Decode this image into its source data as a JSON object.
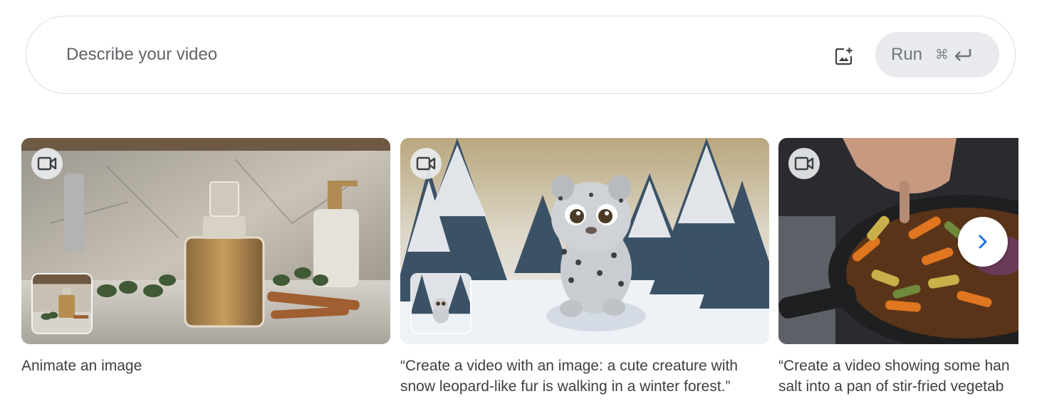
{
  "prompt": {
    "placeholder": "Describe your video",
    "value": "",
    "media_icon": "add-photo-icon",
    "run_label": "Run",
    "run_shortcut": "⌘",
    "enter_icon": "enter-arrow-icon"
  },
  "cards": [
    {
      "caption_lines": [
        "Animate an image"
      ],
      "badge_icon": "video-camera-icon",
      "has_thumbnail": true
    },
    {
      "caption_lines": [
        "“Create a video with an image: a cute creature with",
        "snow leopard-like fur is walking in a winter forest.”"
      ],
      "badge_icon": "video-camera-icon",
      "has_thumbnail": true
    },
    {
      "caption_lines": [
        "“Create a video showing some han",
        "salt into a pan of stir-fried vegetab"
      ],
      "badge_icon": "video-camera-icon",
      "has_thumbnail": false
    }
  ],
  "carousel": {
    "next_icon": "chevron-right-icon"
  },
  "colors": {
    "accent": "#1a73e8",
    "run_bg": "#e8eaed",
    "border": "#dadce0"
  }
}
